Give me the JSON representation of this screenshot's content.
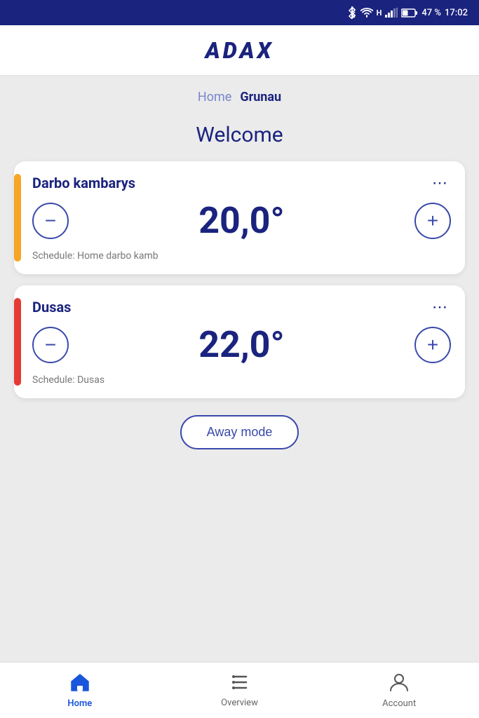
{
  "status_bar": {
    "battery": "47 %",
    "time": "17:02"
  },
  "header": {
    "logo": "ADAX"
  },
  "breadcrumb": {
    "home_label": "Home",
    "current_label": "Grunau"
  },
  "welcome": {
    "title": "Welcome"
  },
  "cards": [
    {
      "id": "card-1",
      "name": "Darbo kambarys",
      "temperature": "20,0°",
      "schedule": "Schedule: Home darbo kamb",
      "accent_color": "yellow",
      "menu_icon": "⋯"
    },
    {
      "id": "card-2",
      "name": "Dusas",
      "temperature": "22,0°",
      "schedule": "Schedule: Dusas",
      "accent_color": "orange",
      "menu_icon": "⋯"
    }
  ],
  "away_mode": {
    "label": "Away mode"
  },
  "bottom_nav": {
    "items": [
      {
        "id": "home",
        "label": "Home",
        "active": true
      },
      {
        "id": "overview",
        "label": "Overview",
        "active": false
      },
      {
        "id": "account",
        "label": "Account",
        "active": false
      }
    ]
  },
  "buttons": {
    "decrease": "−",
    "increase": "+"
  }
}
